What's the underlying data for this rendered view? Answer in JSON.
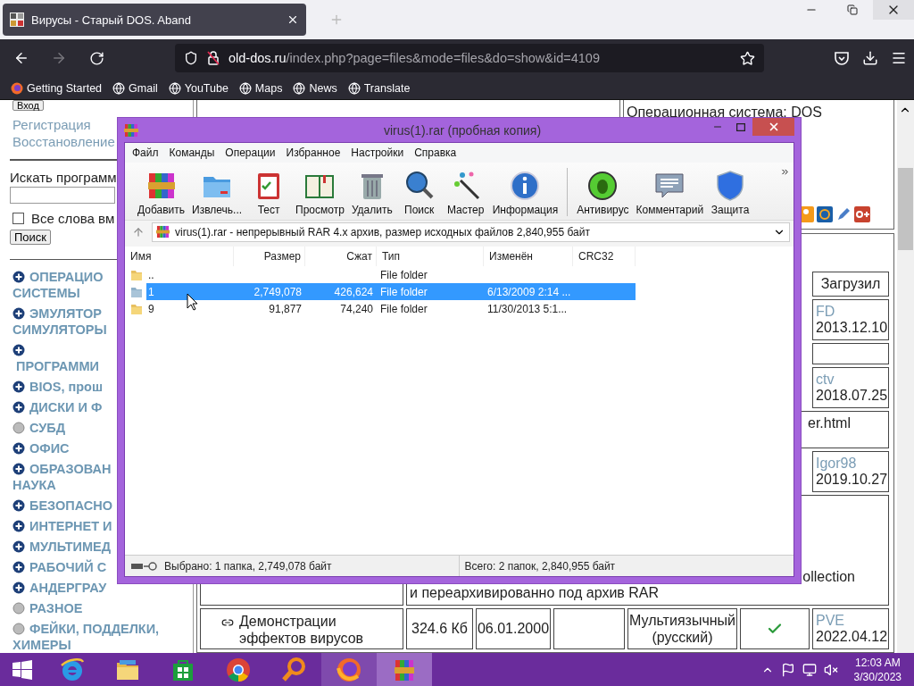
{
  "browser": {
    "tab": {
      "title": "Вирусы - Старый DOS. Aband",
      "selected": true
    },
    "url": {
      "domain": "old-dos.ru",
      "path": "/index.php?page=files&mode=files&do=show&id=4109"
    },
    "bookmarks": [
      "Getting Started",
      "Gmail",
      "YouTube",
      "Maps",
      "News",
      "Translate"
    ]
  },
  "page": {
    "sidebar": {
      "login_button": "Вход",
      "links": [
        "Регистрация",
        "Восстановление"
      ],
      "search_label": "Искать программ",
      "all_words": {
        "label": "Все слова вм",
        "checked": false
      },
      "search_button": "Поиск",
      "categories": [
        {
          "kind": "plus",
          "lines": [
            "ОПЕРАЦИО",
            "СИСТЕМЫ"
          ]
        },
        {
          "kind": "plus",
          "lines": [
            "ЭМУЛЯТОР",
            "СИМУЛЯТОРЫ"
          ]
        },
        {
          "kind": "plus",
          "lines": [
            "ПРОГРАММИ"
          ],
          "break_after_icon": true
        },
        {
          "kind": "plus",
          "lines": [
            "BIOS, прош"
          ]
        },
        {
          "kind": "plus",
          "lines": [
            "ДИСКИ И Ф"
          ]
        },
        {
          "kind": "dot",
          "lines": [
            "СУБД"
          ]
        },
        {
          "kind": "plus",
          "lines": [
            "ОФИС"
          ]
        },
        {
          "kind": "plus",
          "lines": [
            "ОБРАЗОВАН",
            "НАУКА"
          ]
        },
        {
          "kind": "plus",
          "lines": [
            "БЕЗОПАСНО"
          ]
        },
        {
          "kind": "plus",
          "lines": [
            "ИНТЕРНЕТ И"
          ]
        },
        {
          "kind": "plus",
          "lines": [
            "МУЛЬТИМЕД"
          ]
        },
        {
          "kind": "plus",
          "lines": [
            "РАБОЧИЙ С"
          ]
        },
        {
          "kind": "plus",
          "lines": [
            "АНДЕРГРАУ"
          ]
        },
        {
          "kind": "dot",
          "lines": [
            "РАЗНОЕ"
          ]
        },
        {
          "kind": "dot",
          "lines": [
            "ФЕЙКИ, ПОДДЕЛКИ,",
            "ХИМЕРЫ"
          ]
        }
      ]
    },
    "os_text": "Операционная система: DOS",
    "table": {
      "header": "Загрузил",
      "rows": [
        {
          "kind": "uploader",
          "user": "FD",
          "date": "2013.12.10"
        },
        {
          "kind": "blank"
        },
        {
          "kind": "uploader",
          "user": "ctv",
          "date": "2018.07.25"
        },
        {
          "kind": "note",
          "text": "er.html"
        },
        {
          "kind": "uploader",
          "user": "Igor98",
          "date": "2019.10.27"
        },
        {
          "kind": "description",
          "lines": [
            "ollection",
            "и переархивированно под архив RAR"
          ]
        },
        {
          "kind": "file",
          "name": "Демонстрации эффектов вирусов",
          "size": "324.6 Кб",
          "date": "06.01.2000",
          "language": "Мультиязычный (русский)",
          "verified": true,
          "user": "PVE",
          "uploaded": "2022.04.12"
        }
      ]
    }
  },
  "winrar": {
    "title": "virus(1).rar (пробная копия)",
    "menu": [
      "Файл",
      "Команды",
      "Операции",
      "Избранное",
      "Настройки",
      "Справка"
    ],
    "toolbar_groups": [
      {
        "items": [
          "Добавить",
          "Извлечь...",
          "Тест",
          "Просмотр",
          "Удалить",
          "Поиск",
          "Мастер",
          "Информация"
        ]
      },
      {
        "items": [
          "Антивирус",
          "Комментарий",
          "Защита"
        ]
      }
    ],
    "path": "virus(1).rar - непрерывный RAR 4.x архив, размер исходных файлов 2,840,955 байт",
    "columns": [
      "Имя",
      "Размер",
      "Сжат",
      "Тип",
      "Изменён",
      "CRC32"
    ],
    "files": [
      {
        "name": "..",
        "type": "File folder",
        "selected": false
      },
      {
        "name": "1",
        "size": "2,749,078",
        "packed": "426,624",
        "type": "File folder",
        "modified": "6/13/2009 2:14 ...",
        "selected": true
      },
      {
        "name": "9",
        "size": "91,877",
        "packed": "74,240",
        "type": "File folder",
        "modified": "11/30/2013 5:1...",
        "selected": false
      }
    ],
    "status": {
      "selected": "Выбрано: 1 папка, 2,749,078 байт",
      "total": "Всего: 2 папок, 2,840,955 байт"
    }
  },
  "taskbar": {
    "apps": [
      {
        "running": false,
        "selected": false
      },
      {
        "running": false,
        "selected": false
      },
      {
        "running": false,
        "selected": false
      },
      {
        "running": false,
        "selected": false
      },
      {
        "running": false,
        "selected": false
      },
      {
        "running": true,
        "selected": false
      },
      {
        "running": true,
        "selected": true
      }
    ],
    "clock": {
      "time": "12:03 AM",
      "date": "3/30/2023"
    }
  }
}
